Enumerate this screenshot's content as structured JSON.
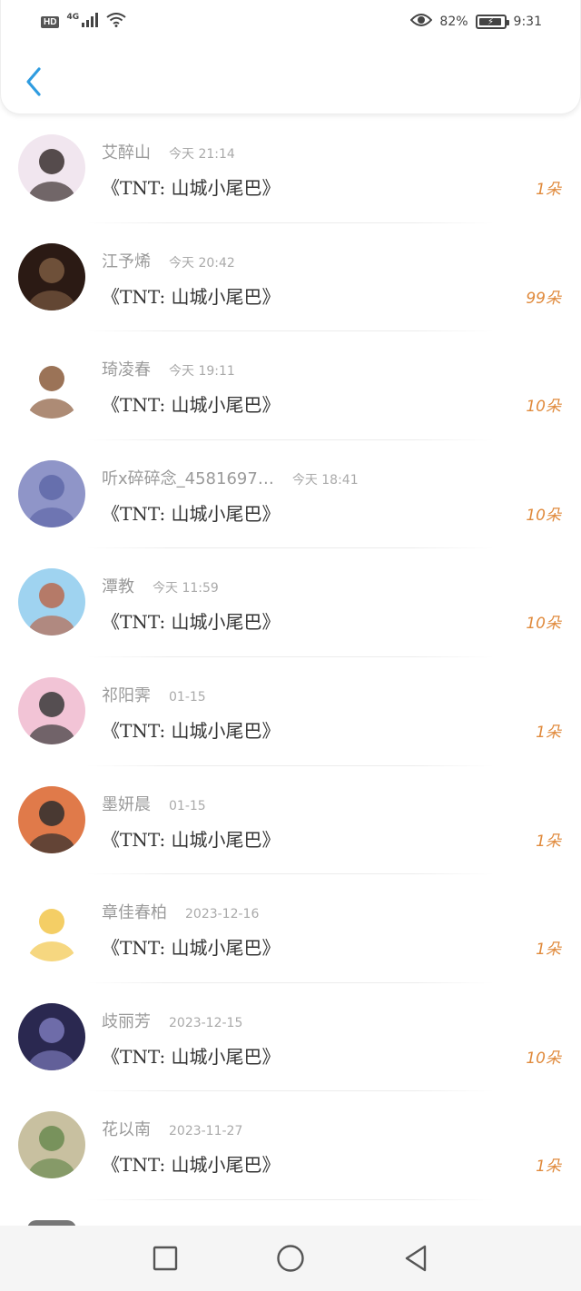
{
  "status_bar": {
    "hd": "HD",
    "network": "4G",
    "battery_percent": "82%",
    "time": "9:31",
    "accent": "#444444"
  },
  "header": {
    "back_icon": "chevron-left-icon",
    "accent": "#2f9ce0"
  },
  "list": {
    "items": [
      {
        "name": "艾醉山",
        "time": "今天 21:14",
        "title": "《TNT: 山城小尾巴》",
        "gift": "1朵",
        "avatar_colors": [
          "#f1e6ef",
          "#3a2f2f"
        ]
      },
      {
        "name": "江予烯",
        "time": "今天 20:42",
        "title": "《TNT: 山城小尾巴》",
        "gift": "99朵",
        "avatar_colors": [
          "#2b1a14",
          "#7a5a40"
        ]
      },
      {
        "name": "琦凌春",
        "time": "今天 19:11",
        "title": "《TNT: 山城小尾巴》",
        "gift": "10朵",
        "avatar_colors": [
          "#ffffff",
          "#8a5a3a"
        ]
      },
      {
        "name": "听x碎碎念_4581697…",
        "time": "今天 18:41",
        "title": "《TNT: 山城小尾巴》",
        "gift": "10朵",
        "avatar_colors": [
          "#8f95c8",
          "#5f68a8"
        ]
      },
      {
        "name": "潭教",
        "time": "今天 11:59",
        "title": "《TNT: 山城小尾巴》",
        "gift": "10朵",
        "avatar_colors": [
          "#9fd3f0",
          "#b86a50"
        ]
      },
      {
        "name": "祁阳霁",
        "time": "01-15",
        "title": "《TNT: 山城小尾巴》",
        "gift": "1朵",
        "avatar_colors": [
          "#f2c4d6",
          "#3a3a3a"
        ]
      },
      {
        "name": "墨妍晨",
        "time": "01-15",
        "title": "《TNT: 山城小尾巴》",
        "gift": "1朵",
        "avatar_colors": [
          "#e07a4a",
          "#2e2e2e"
        ]
      },
      {
        "name": "章佳春柏",
        "time": "2023-12-16",
        "title": "《TNT: 山城小尾巴》",
        "gift": "1朵",
        "avatar_colors": [
          "#ffffff",
          "#f2c64a"
        ]
      },
      {
        "name": "歧丽芳",
        "time": "2023-12-15",
        "title": "《TNT: 山城小尾巴》",
        "gift": "10朵",
        "avatar_colors": [
          "#2a2850",
          "#7a78b8"
        ]
      },
      {
        "name": "花以南",
        "time": "2023-11-27",
        "title": "《TNT: 山城小尾巴》",
        "gift": "1朵",
        "avatar_colors": [
          "#c8c0a0",
          "#6a8a50"
        ]
      }
    ]
  },
  "navbar": {
    "recent_icon": "square-icon",
    "home_icon": "circle-icon",
    "back_icon": "triangle-back-icon"
  }
}
